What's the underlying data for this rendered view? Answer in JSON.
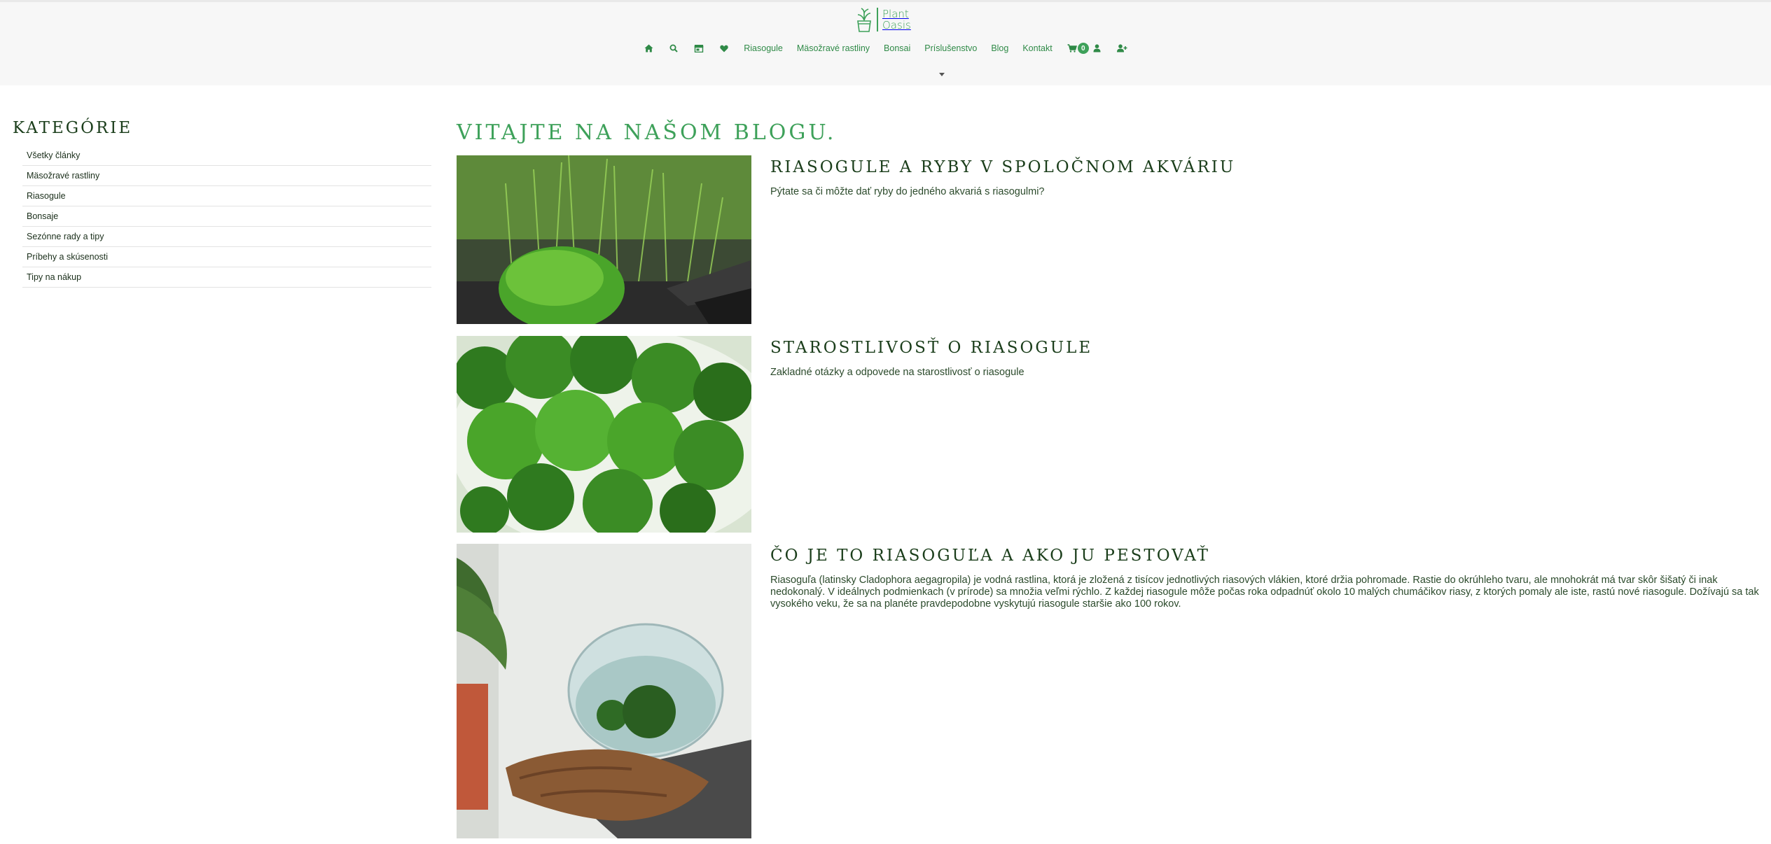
{
  "brand": {
    "name_line1": "Plant",
    "name_line2": "Oasis"
  },
  "nav": {
    "icons": [
      "home-icon",
      "search-icon",
      "store-icon",
      "heart-icon"
    ],
    "links": [
      "Riasogule",
      "Mäsožravé rastliny",
      "Bonsai",
      "Príslušenstvo",
      "Blog",
      "Kontakt"
    ],
    "cart_count": "0"
  },
  "sidebar": {
    "title": "KATEGÓRIE",
    "items": [
      "Všetky články",
      "Mäsožravé rastliny",
      "Riasogule",
      "Bonsaje",
      "Sezónne rady a tipy",
      "Príbehy a skúsenosti",
      "Tipy na nákup"
    ]
  },
  "main": {
    "title": "VITAJTE NA NAŠOM BLOGU.",
    "posts": [
      {
        "title": "RIASOGULE A RYBY V SPOLOČNOM AKVÁRIU",
        "excerpt": "Pýtate sa či môžte dať ryby do jedného akvariá s riasogulmi?"
      },
      {
        "title": "STAROSTLIVOSŤ O RIASOGULE",
        "excerpt": "Zakladné otázky a odpovede na starostlivosť o riasogule"
      },
      {
        "title": "ČO JE TO RIASOGUĽA A AKO JU PESTOVAŤ",
        "excerpt": "Riasoguľa (latinsky Cladophora aegagropila) je vodná rastlina, ktorá je zložená z tisícov jednotlivých riasových vlákien, ktoré držia pohromade. Rastie do okrúhleho tvaru, ale mnohokrát má tvar skôr šišatý či inak nedokonalý. V ideálnych podmienkach (v prírode) sa množia veľmi rýchlo. Z každej riasogule môže počas roka odpadnúť okolo 10 malých chumáčikov riasy, z ktorých pomaly ale iste, rastú nové riasogule. Dožívajú sa tak vysokého veku, že sa na planéte pravdepodobne vyskytujú riasogule staršie ako 100 rokov."
      }
    ]
  },
  "colors": {
    "accent": "#3ea15a",
    "heading": "#1a3d1a",
    "header_bg": "#f7f7f7"
  }
}
